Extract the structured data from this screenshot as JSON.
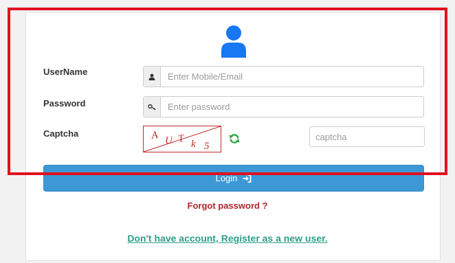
{
  "form": {
    "username_label": "UserName",
    "username_placeholder": "Enter Mobile/Email",
    "password_label": "Password",
    "password_placeholder": "Enter password",
    "captcha_label": "Captcha",
    "captcha_chars": [
      "A",
      "U",
      "T",
      "k",
      "5"
    ],
    "captcha_placeholder": "captcha",
    "login_label": "Login"
  },
  "links": {
    "forgot": "Forgot password ?",
    "register": "Don't have account, Register as a new user."
  },
  "icons": {
    "avatar": "user-icon",
    "username_addon": "user-small-icon",
    "password_addon": "key-icon",
    "refresh": "refresh-icon",
    "login": "sign-in-icon"
  },
  "colors": {
    "highlight_border": "#e0101e",
    "avatar": "#1877f2",
    "login_button": "#3d99d6",
    "forgot_link": "#b0262b",
    "register_link": "#2d9e88",
    "refresh_icon": "#2ea84a",
    "captcha_text": "#c22a2a"
  }
}
